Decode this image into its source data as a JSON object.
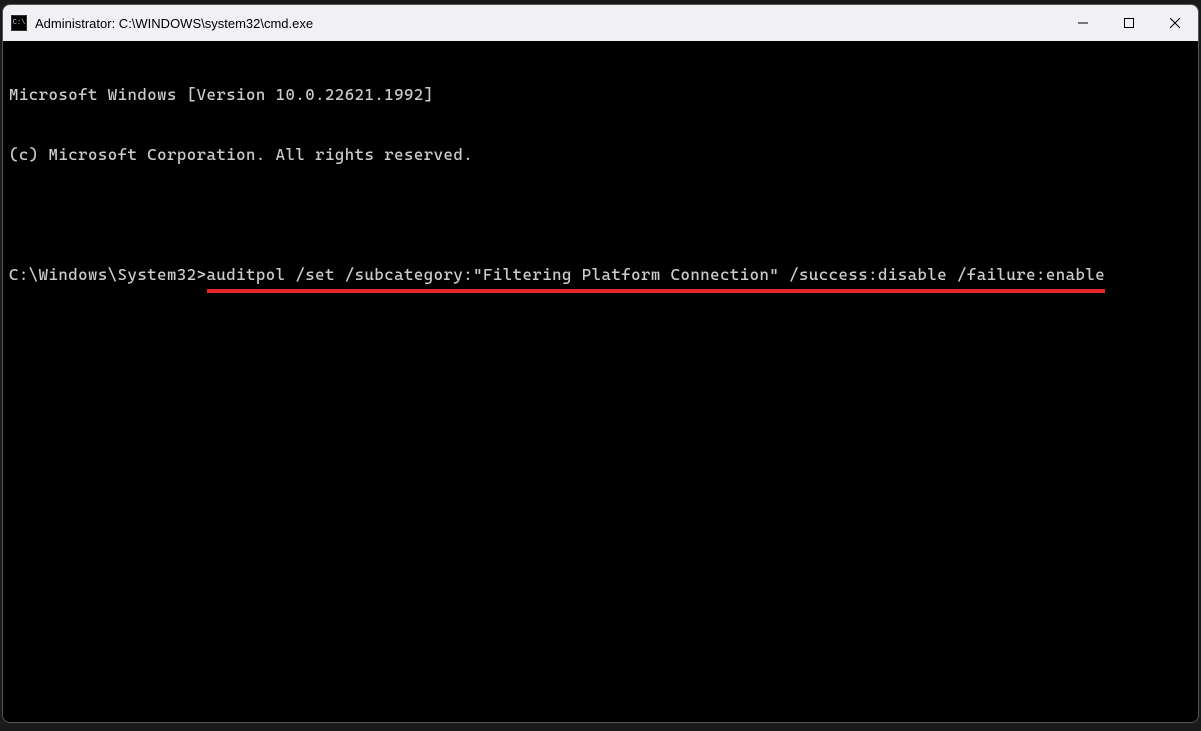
{
  "titlebar": {
    "icon_text": "C:\\",
    "title": "Administrator: C:\\WINDOWS\\system32\\cmd.exe"
  },
  "terminal": {
    "line1": "Microsoft Windows [Version 10.0.22621.1992]",
    "line2": "(c) Microsoft Corporation. All rights reserved.",
    "prompt": "C:\\Windows\\System32>",
    "command": "auditpol /set /subcategory:\"Filtering Platform Connection\" /success:disable /failure:enable"
  },
  "annotation": {
    "underline_color": "#e82727"
  }
}
